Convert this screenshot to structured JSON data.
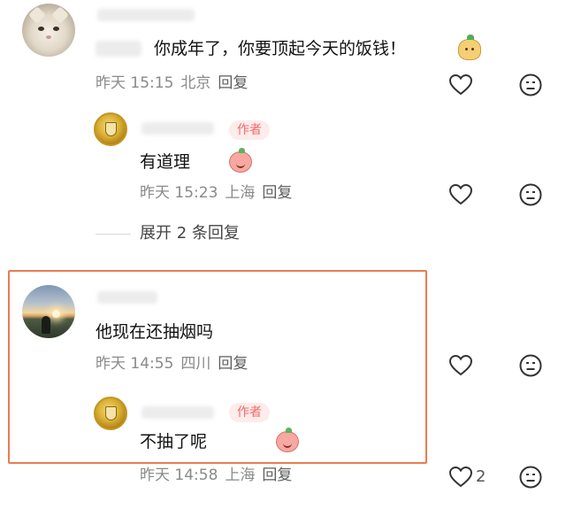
{
  "comments": [
    {
      "user_name_blurred": "",
      "prefix_blurred": "",
      "text": "你成年了，你要顶起今天的饭钱！",
      "emoji": "dough-face-emoji",
      "time": "昨天 15:15",
      "location": "北京",
      "reply_label": "回复",
      "likes": ""
    },
    {
      "user_name_blurred": "",
      "badge": "作者",
      "text": "有道理",
      "emoji": "peach-face-emoji",
      "time": "昨天 15:23",
      "location": "上海",
      "reply_label": "回复",
      "likes": ""
    },
    {
      "user_name_blurred": "",
      "text": "他现在还抽烟吗",
      "time": "昨天 14:55",
      "location": "四川",
      "reply_label": "回复",
      "likes": ""
    },
    {
      "user_name_blurred": "",
      "badge": "作者",
      "text": "不抽了呢",
      "emoji": "peach-face-emoji",
      "time": "昨天 14:58",
      "location": "上海",
      "reply_label": "回复",
      "likes": "2"
    }
  ],
  "expand_replies": "展开 2 条回复",
  "colors": {
    "highlight_border": "#ea7d4e",
    "author_badge_text": "#f06a6a",
    "author_badge_bg": "#fdeceb",
    "meta_text": "#8a8a8a"
  },
  "icons": [
    "heart-icon",
    "dislike-face-icon"
  ]
}
